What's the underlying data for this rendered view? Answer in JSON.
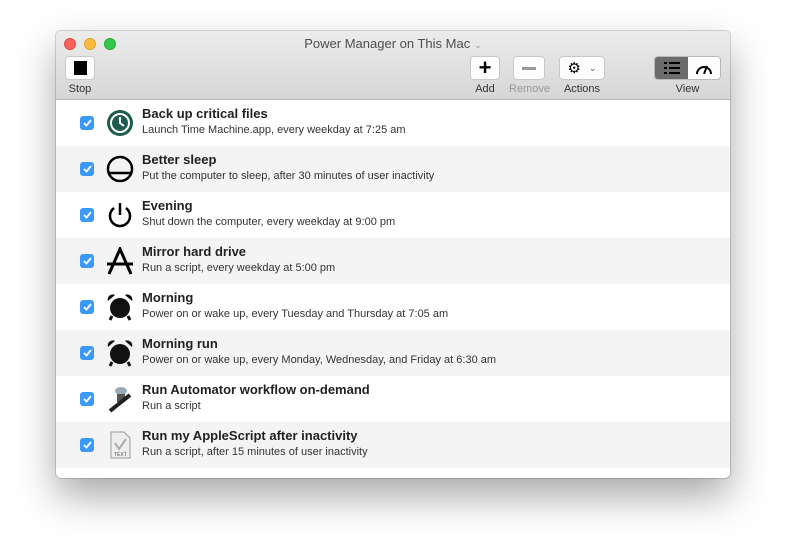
{
  "window": {
    "title": "Power Manager on This Mac"
  },
  "toolbar": {
    "stop": "Stop",
    "add": "Add",
    "remove": "Remove",
    "actions": "Actions",
    "view": "View"
  },
  "events": [
    {
      "name": "Back up critical files",
      "desc": "Launch Time Machine.app, every weekday at 7:25 am",
      "icon": "time-machine-icon",
      "checked": true
    },
    {
      "name": "Better sleep",
      "desc": "Put the computer to sleep, after 30 minutes of user inactivity",
      "icon": "sleep-icon",
      "checked": true
    },
    {
      "name": "Evening",
      "desc": "Shut down the computer, every weekday at 9:00 pm",
      "icon": "power-icon",
      "checked": true
    },
    {
      "name": "Mirror hard drive",
      "desc": "Run a script, every weekday at 5:00 pm",
      "icon": "script-icon",
      "checked": true
    },
    {
      "name": "Morning",
      "desc": "Power on or wake up, every Tuesday and Thursday at 7:05 am",
      "icon": "alarm-clock-icon",
      "checked": true
    },
    {
      "name": "Morning run",
      "desc": "Power on or wake up, every Monday, Wednesday, and Friday at 6:30 am",
      "icon": "alarm-clock-icon",
      "checked": true
    },
    {
      "name": "Run Automator workflow on-demand",
      "desc": "Run a script",
      "icon": "automator-icon",
      "checked": true
    },
    {
      "name": "Run my AppleScript after inactivity",
      "desc": "Run a script, after 15 minutes of user inactivity",
      "icon": "text-document-icon",
      "checked": true
    }
  ]
}
